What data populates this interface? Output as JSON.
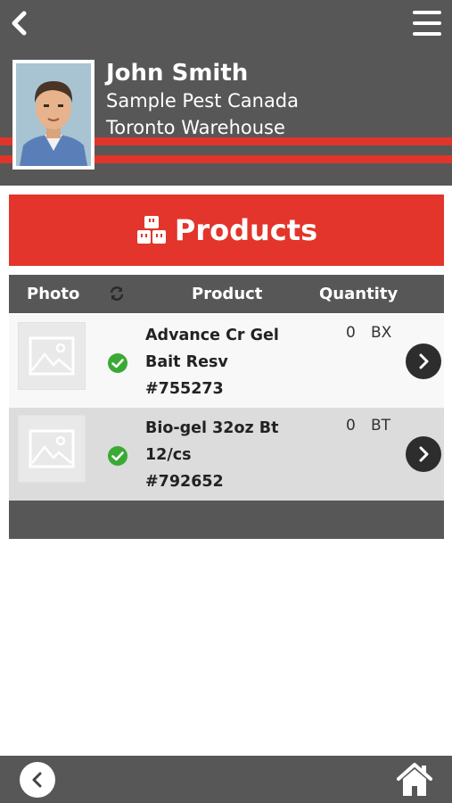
{
  "header": {
    "user_name": "John Smith",
    "company": "Sample Pest Canada",
    "location": "Toronto Warehouse",
    "accent_color": "#e3352b",
    "background_color": "#575757",
    "icons": {
      "back": "chevron-left-icon",
      "menu": "hamburger-menu-icon"
    }
  },
  "banner": {
    "title": "Products",
    "icon": "boxes-icon"
  },
  "table": {
    "columns": {
      "photo": "Photo",
      "sync_icon": "sync-icon",
      "product": "Product",
      "quantity": "Quantity"
    },
    "rows": [
      {
        "name_line1": "Advance Cr Gel",
        "name_line2": "Bait Resv",
        "code": "#755273",
        "quantity": "0",
        "unit": "BX",
        "status_icon": "check-badge-icon",
        "status_color": "#3aaa35"
      },
      {
        "name_line1": "Bio-gel 32oz Bt",
        "name_line2": "12/cs",
        "code": "#792652",
        "quantity": "0",
        "unit": "BT",
        "status_icon": "check-badge-icon",
        "status_color": "#3aaa35"
      }
    ]
  },
  "bottom_bar": {
    "icons": {
      "back": "chevron-left-circle-icon",
      "home": "home-icon"
    }
  }
}
